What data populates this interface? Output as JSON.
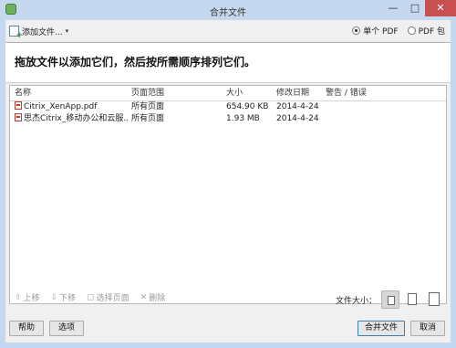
{
  "window": {
    "title": "合并文件",
    "minimize_glyph": "—",
    "maximize_glyph": "□",
    "close_glyph": "✕"
  },
  "toolbar": {
    "add_files_label": "添加文件...",
    "add_files_caret": "▾",
    "add_files_icon": "add-file-icon",
    "radio_options": [
      {
        "label": "单个 PDF",
        "selected": true
      },
      {
        "label": "PDF 包",
        "selected": false
      }
    ]
  },
  "instruction": "拖放文件以添加它们，然后按所需顺序排列它们。",
  "table": {
    "columns": [
      "名称",
      "页面范围",
      "大小",
      "修改日期",
      "警告 / 错误"
    ],
    "rows": [
      {
        "name": "Citrix_XenApp.pdf",
        "range": "所有页面",
        "size": "654.90 KB",
        "date": "2014-4-24 ...",
        "warn": ""
      },
      {
        "name": "思杰Citrix_移动办公和云服...",
        "range": "所有页面",
        "size": "1.93 MB",
        "date": "2014-4-24 ...",
        "warn": ""
      }
    ],
    "file_icon": "pdf-file-icon"
  },
  "actions": [
    {
      "label": "上移",
      "icon": "arrow-up-icon",
      "glyph": "⇧"
    },
    {
      "label": "下移",
      "icon": "arrow-down-icon",
      "glyph": "⇩"
    },
    {
      "label": "选择页面",
      "icon": "select-pages-icon",
      "glyph": "▢"
    },
    {
      "label": "删除",
      "icon": "delete-icon",
      "glyph": "✕"
    }
  ],
  "file_size": {
    "label": "文件大小：",
    "options": [
      "smaller",
      "default",
      "larger"
    ],
    "selected": "smaller"
  },
  "footer": {
    "help_label": "帮助",
    "options_label": "选项",
    "combine_label": "合并文件",
    "cancel_label": "取消"
  }
}
